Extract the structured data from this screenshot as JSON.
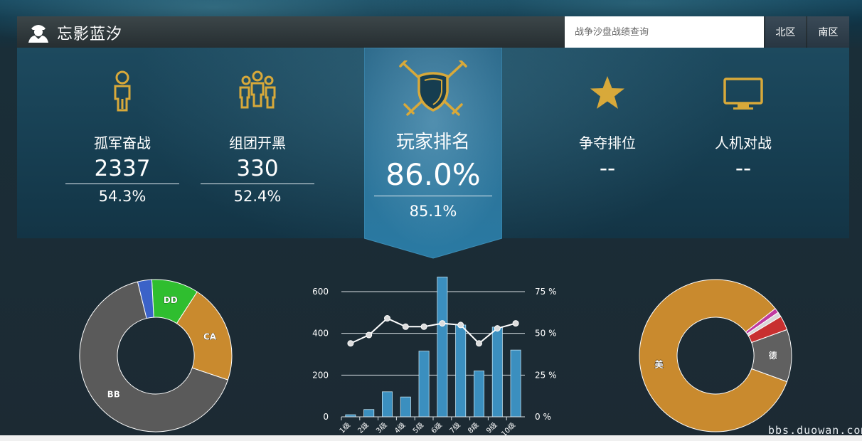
{
  "header": {
    "player_name": "忘影蓝汐",
    "search_placeholder": "战争沙盘战绩查询",
    "buttons": {
      "north": "北区",
      "south": "南区"
    }
  },
  "stats": [
    {
      "key": "solo",
      "label": "孤军奋战",
      "value": "2337",
      "rate": "54.3%",
      "icon": "single-player-icon"
    },
    {
      "key": "team",
      "label": "组团开黑",
      "value": "330",
      "rate": "52.4%",
      "icon": "team-icon"
    },
    {
      "key": "ranked",
      "label": "争夺排位",
      "value": "--",
      "rate": "",
      "icon": "star-icon"
    },
    {
      "key": "pve",
      "label": "人机对战",
      "value": "--",
      "rate": "",
      "icon": "monitor-icon"
    }
  ],
  "ranking": {
    "label": "玩家排名",
    "value": "86.0%",
    "sub": "85.1%",
    "icon": "shield-swords-icon"
  },
  "colors": {
    "gold": "#d8a93a",
    "bar": "#3b8fbf",
    "dd": "#2fbe2f",
    "ca": "#c98a2e",
    "bb": "#5a5a5a",
    "cv": "#3b62c8"
  },
  "chart_data": [
    {
      "type": "pie",
      "name": "class",
      "categories": [
        "DD",
        "CA",
        "BB",
        ""
      ],
      "values": [
        10,
        21,
        66,
        3
      ],
      "colors": [
        "#2fbe2f",
        "#c98a2e",
        "#5a5a5a",
        "#3b62c8"
      ]
    },
    {
      "type": "bar",
      "name": "tier",
      "categories": [
        "1级",
        "2级",
        "3级",
        "4级",
        "5级",
        "6级",
        "7级",
        "8级",
        "9级",
        "10级"
      ],
      "series": [
        {
          "type": "bar",
          "axis": "left",
          "values": [
            10,
            35,
            120,
            95,
            315,
            670,
            440,
            220,
            430,
            320
          ]
        },
        {
          "type": "line",
          "axis": "right",
          "values": [
            44,
            49,
            59,
            54,
            54,
            56,
            55,
            44,
            53,
            56
          ]
        }
      ],
      "ylim": [
        0,
        600
      ],
      "yticks": [
        0,
        200,
        400,
        600
      ],
      "y2lim": [
        0,
        75
      ],
      "y2ticks": [
        "0 %",
        "25 %",
        "50 %",
        "75 %"
      ]
    },
    {
      "type": "pie",
      "name": "nation",
      "categories": [
        "德",
        "美",
        "",
        "",
        ""
      ],
      "values": [
        11,
        83,
        1,
        1,
        3
      ],
      "colors": [
        "#606060",
        "#c98a2e",
        "#c03aa0",
        "#d8d8d8",
        "#c83030"
      ]
    }
  ],
  "watermark": "bbs.duowan.com"
}
